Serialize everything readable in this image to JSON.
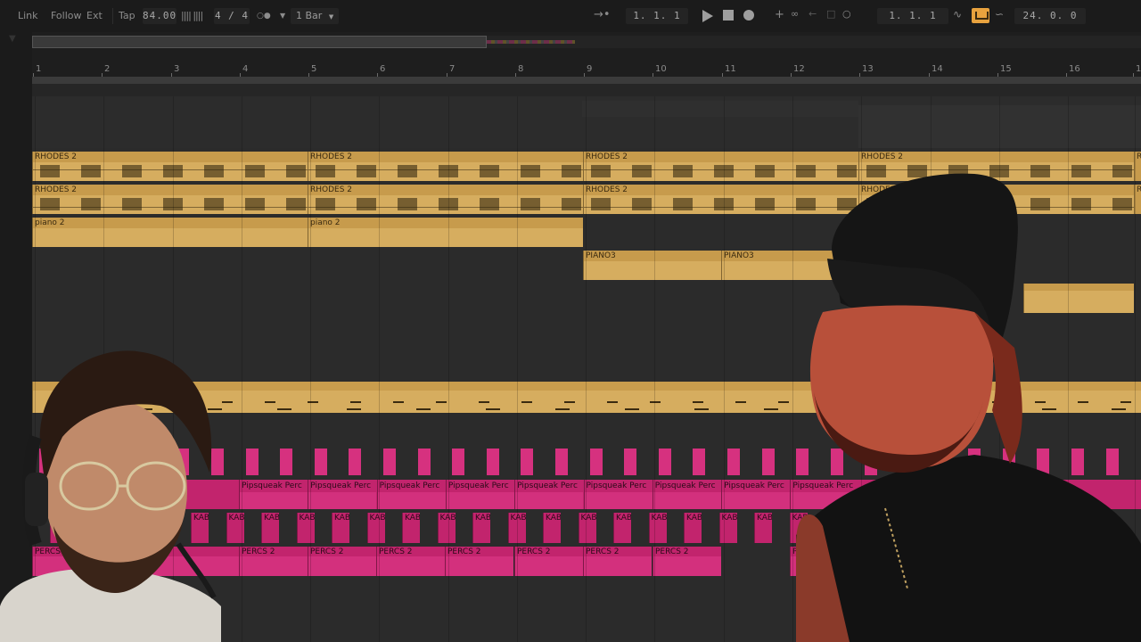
{
  "transport": {
    "link": "Link",
    "follow": "Follow",
    "ext": "Ext",
    "tap": "Tap",
    "tempo": "84.00",
    "signature": "4 / 4",
    "quantize": "1 Bar",
    "arrangement_position": "1.  1.  1",
    "loop_start": "1.  1.  1",
    "loop_length": "24.  0.  0",
    "loop_active": true,
    "accent_color": "#e8a23e"
  },
  "ruler": {
    "bars": [
      "1",
      "2",
      "3",
      "4",
      "5",
      "6",
      "7",
      "8",
      "9",
      "10",
      "11",
      "12",
      "13",
      "14",
      "15",
      "16",
      "1"
    ]
  },
  "tracks": {
    "rhodes_a": [
      "RHODES 2",
      "RHODES 2",
      "RHODES 2",
      "RHODES 2",
      "R"
    ],
    "rhodes_b": [
      "RHODES 2",
      "RHODES 2",
      "RHODES 2",
      "RHODES 2",
      "R"
    ],
    "piano2": [
      "piano 2",
      "piano 2"
    ],
    "piano3": [
      "PIANO3",
      "PIANO3"
    ],
    "pipsqueak": [
      "Pipsqueak Perc",
      "Pipsqueak Perc",
      "Pipsqueak Perc",
      "Pipsqueak Perc",
      "Pipsqueak Perc",
      "Pipsqueak Perc",
      "Pipsqueak Perc",
      "Pipsqueak Perc",
      "Pipsqueak Perc"
    ],
    "percs": [
      "PERCS 2",
      "PERCS 2",
      "PERCS 2",
      "PERCS 2",
      "PERCS 2",
      "PERCS 2",
      "PERCS 2",
      "PERCS 2",
      "PERCS"
    ],
    "kab": [
      "KAB",
      "KAB",
      "KAB",
      "KAB",
      "KAB",
      "KAB",
      "KAB",
      "KAB",
      "KAB",
      "KAB",
      "KAB",
      "KAB",
      "KAB",
      "KAB",
      "KAB",
      "KAB",
      "KAB",
      "KAB",
      "KAB",
      "KAB",
      "KAB",
      "KAB",
      "KAB"
    ]
  },
  "colors": {
    "gold_clip": "#c79b4c",
    "pink_clip": "#c2246d"
  }
}
